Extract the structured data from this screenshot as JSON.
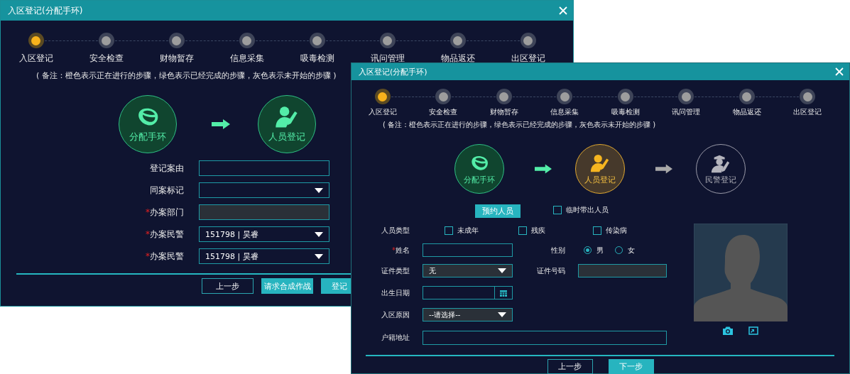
{
  "back_window": {
    "title": "入区登记(分配手环)",
    "steps": [
      {
        "label": "入区登记",
        "kind": "current"
      },
      {
        "label": "安全检查",
        "kind": "pending"
      },
      {
        "label": "财物暂存",
        "kind": "pending"
      },
      {
        "label": "信息采集",
        "kind": "pending"
      },
      {
        "label": "吸毒检测",
        "kind": "pending"
      },
      {
        "label": "讯问管理",
        "kind": "pending"
      },
      {
        "label": "物品返还",
        "kind": "pending"
      },
      {
        "label": "出区登记",
        "kind": "pending"
      }
    ],
    "note": "( 备注：橙色表示正在进行的步骤，绿色表示已经完成的步骤，灰色表示未开始的步骤 )",
    "phases": [
      {
        "label": "分配手环",
        "kind": "done"
      },
      {
        "label": "人员登记",
        "kind": "done"
      }
    ],
    "form": [
      {
        "label": "登记案由",
        "kind": "text"
      },
      {
        "label": "同案标记",
        "kind": "select"
      },
      {
        "label": "办案部门",
        "mark": "*",
        "kind": "readonly"
      },
      {
        "label": "办案民警",
        "mark": "*",
        "kind": "select",
        "value": "151798 | 昊睿"
      },
      {
        "label": "办案民警",
        "mark": "*",
        "kind": "select",
        "value": "151798 | 昊睿"
      }
    ],
    "buttons": [
      {
        "label": "上一步",
        "kind": "outline"
      },
      {
        "label": "请求合成作战",
        "kind": "primary"
      },
      {
        "label": "登记",
        "kind": "primary"
      }
    ]
  },
  "front_window": {
    "title": "入区登记(分配手环)",
    "steps": [
      {
        "label": "入区登记",
        "kind": "current"
      },
      {
        "label": "安全检查",
        "kind": "pending"
      },
      {
        "label": "财物暂存",
        "kind": "pending"
      },
      {
        "label": "信息采集",
        "kind": "pending"
      },
      {
        "label": "吸毒检测",
        "kind": "pending"
      },
      {
        "label": "讯问管理",
        "kind": "pending"
      },
      {
        "label": "物品返还",
        "kind": "pending"
      },
      {
        "label": "出区登记",
        "kind": "pending"
      }
    ],
    "note": "( 备注：橙色表示正在进行的步骤，绿色表示已经完成的步骤，灰色表示未开始的步骤 )",
    "phases": [
      {
        "label": "分配手环",
        "kind": "done"
      },
      {
        "label": "人员登记",
        "kind": "current"
      },
      {
        "label": "民警登记",
        "kind": "pending"
      }
    ],
    "reserve_button": "预约人员",
    "temp_checkbox": {
      "label": "临时带出人员",
      "checked": false
    },
    "person_type": {
      "label": "人员类型",
      "options": [
        {
          "label": "未成年",
          "checked": false
        },
        {
          "label": "残疾",
          "checked": false
        },
        {
          "label": "传染病",
          "checked": false
        }
      ]
    },
    "name": {
      "label": "姓名",
      "mark": "*"
    },
    "gender": {
      "label": "性别",
      "options": [
        {
          "label": "男",
          "selected": true
        },
        {
          "label": "女",
          "selected": false
        }
      ]
    },
    "id_type": {
      "label": "证件类型",
      "value": "无"
    },
    "id_number": {
      "label": "证件号码"
    },
    "birth_date": {
      "label": "出生日期"
    },
    "entry_reason": {
      "label": "入区原因",
      "value": "--请选择--"
    },
    "address": {
      "label": "户籍地址"
    },
    "buttons": [
      {
        "label": "上一步",
        "kind": "outline"
      },
      {
        "label": "下一步",
        "kind": "primary"
      }
    ]
  }
}
